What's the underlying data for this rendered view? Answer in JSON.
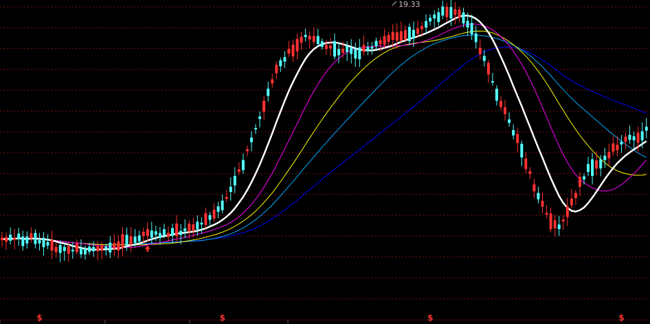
{
  "chart_data": {
    "type": "candlestick",
    "peak_label": "19.33",
    "colors": {
      "background": "#000000",
      "grid": "#7a1010",
      "up": "#ff3232",
      "down": "#54ffff",
      "ma_white": "#ffffff",
      "ma_magenta": "#ff00ff",
      "ma_yellow": "#ffff00",
      "ma_cyan": "#00aaff",
      "ma_blue": "#0000ff",
      "marker": "#ff3232",
      "label": "#c0c0c0"
    },
    "markers": [
      {
        "text": "$",
        "candle": 9
      },
      {
        "text": "$",
        "candle": 53
      },
      {
        "text": "$",
        "candle": 103
      },
      {
        "text": "$",
        "candle": 149
      }
    ],
    "arrow_candle": 35
  }
}
